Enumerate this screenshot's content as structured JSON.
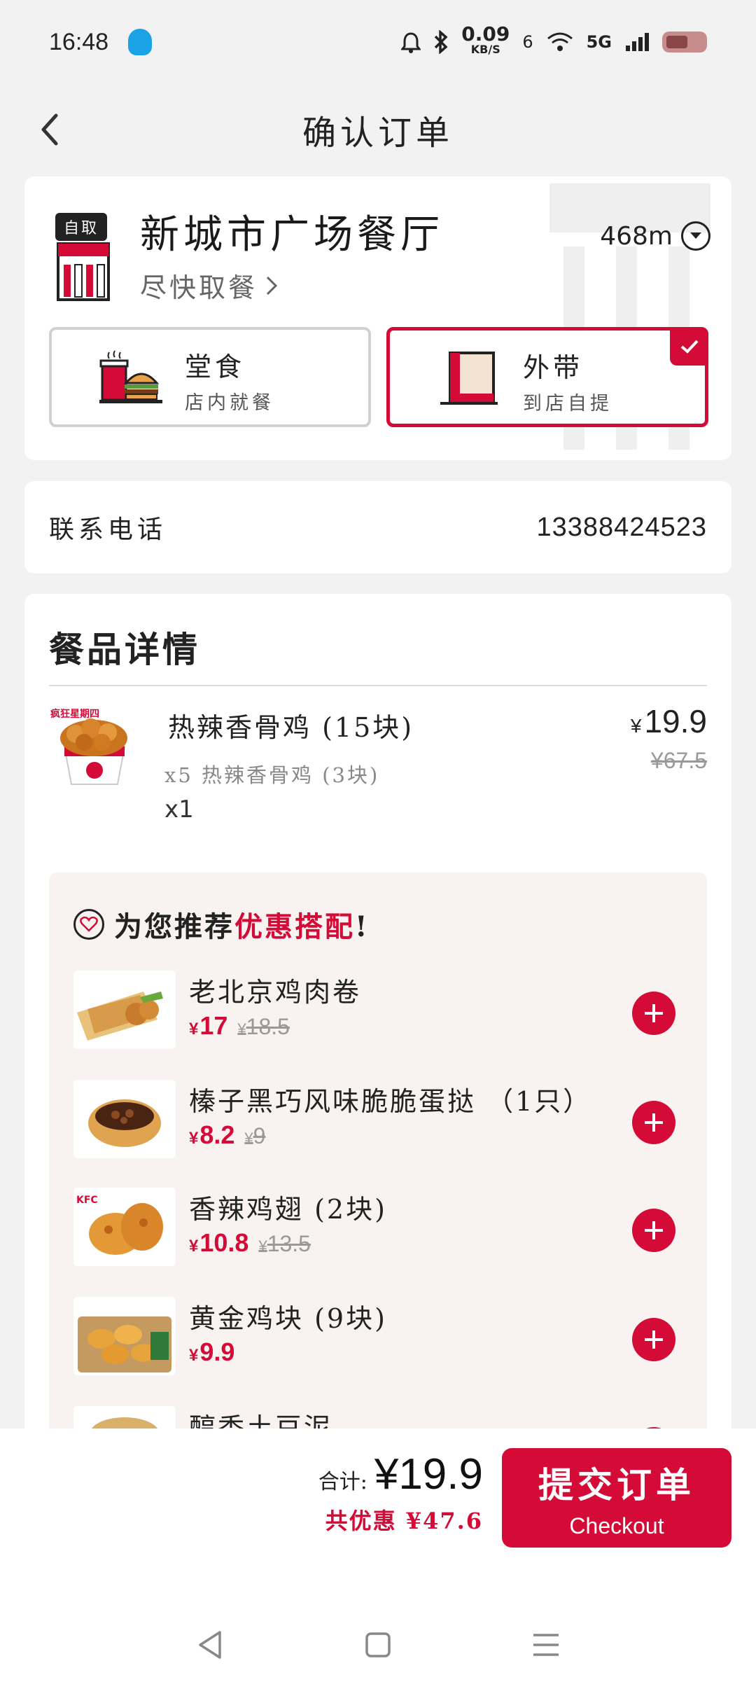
{
  "status_bar": {
    "time": "16:48",
    "net_speed": "0.09",
    "net_unit": "KB/S",
    "signal_label": "5G",
    "sim_num": "6"
  },
  "header": {
    "title": "确认订单"
  },
  "store": {
    "badge": "自取",
    "name": "新城市广场餐厅",
    "pickup_time": "尽快取餐",
    "distance": "468m",
    "modes": [
      {
        "title": "堂食",
        "subtitle": "店内就餐",
        "selected": false
      },
      {
        "title": "外带",
        "subtitle": "到店自提",
        "selected": true
      }
    ],
    "accent": "#d40b37"
  },
  "contact": {
    "label": "联系电话",
    "phone": "13388424523"
  },
  "order": {
    "header": "餐品详情",
    "main_item": {
      "image_tag": "疯狂星期四",
      "name": "热辣香骨鸡 (15块)",
      "subtitle": "x5 热辣香骨鸡 (3块)",
      "quantity": "x1",
      "currency": "¥",
      "price": "19.9",
      "old_price": "¥67.5"
    },
    "recommend": {
      "title_prefix": "为您推荐",
      "title_highlight": "优惠搭配",
      "title_suffix": "!",
      "items": [
        {
          "name": "老北京鸡肉卷",
          "currency": "¥",
          "price": "17",
          "old_currency": "¥",
          "old_price": "18.5"
        },
        {
          "name": "榛子黑巧风味脆脆蛋挞 （1只）",
          "currency": "¥",
          "price": "8.2",
          "old_currency": "¥",
          "old_price": "9"
        },
        {
          "name": "香辣鸡翅 (2块)",
          "currency": "¥",
          "price": "10.8",
          "old_currency": "¥",
          "old_price": "13.5"
        },
        {
          "name": "黄金鸡块 (9块)",
          "currency": "¥",
          "price": "9.9",
          "old_currency": "",
          "old_price": ""
        },
        {
          "name": "醇香土豆泥",
          "currency": "",
          "price": "",
          "old_currency": "",
          "old_price": ""
        }
      ]
    }
  },
  "checkout": {
    "total_label": "合计:",
    "total": "¥19.9",
    "savings": "共优惠 ¥47.6",
    "submit_cn": "提交订单",
    "submit_en": "Checkout"
  }
}
